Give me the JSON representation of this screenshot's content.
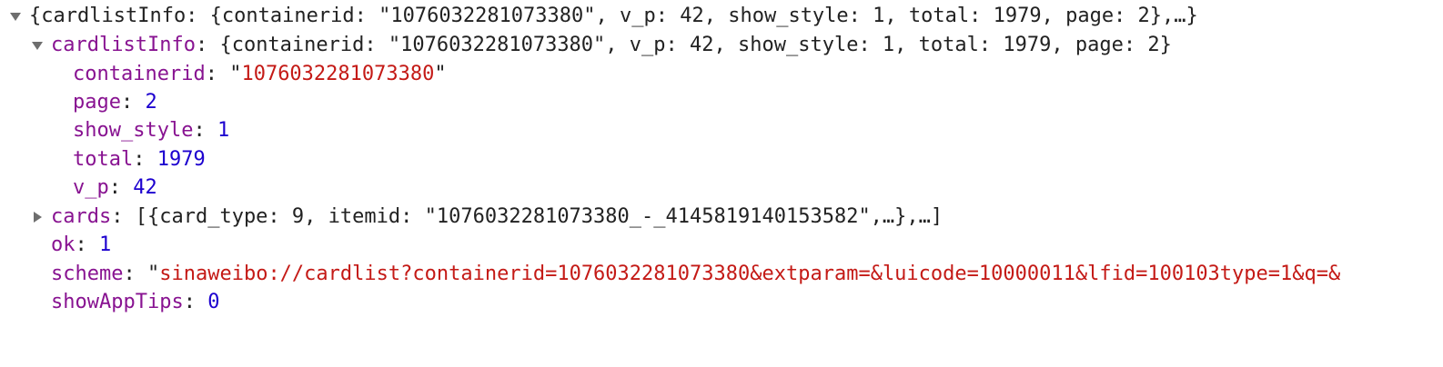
{
  "root": {
    "summary": "{cardlistInfo: {containerid: \"1076032281073380\", v_p: 42, show_style: 1, total: 1979, page: 2},…}"
  },
  "cardlistInfo": {
    "key": "cardlistInfo",
    "summary": "{containerid: \"1076032281073380\", v_p: 42, show_style: 1, total: 1979, page: 2}",
    "containerid": {
      "key": "containerid",
      "value": "1076032281073380"
    },
    "page": {
      "key": "page",
      "value": "2"
    },
    "show_style": {
      "key": "show_style",
      "value": "1"
    },
    "total": {
      "key": "total",
      "value": "1979"
    },
    "v_p": {
      "key": "v_p",
      "value": "42"
    }
  },
  "cards": {
    "key": "cards",
    "summary": "[{card_type: 9, itemid: \"1076032281073380_-_4145819140153582\",…},…]"
  },
  "ok": {
    "key": "ok",
    "value": "1"
  },
  "scheme": {
    "key": "scheme",
    "value": "sinaweibo://cardlist?containerid=1076032281073380&extparam=&luicode=10000011&lfid=100103type=1&q=&"
  },
  "showAppTips": {
    "key": "showAppTips",
    "value": "0"
  },
  "colors": {
    "key": "#881391",
    "string": "#c41a16",
    "number": "#1c00cf",
    "text": "#222222",
    "arrow": "#6e6e6e"
  },
  "icons": {
    "expanded": "triangle-down-icon",
    "collapsed": "triangle-right-icon"
  }
}
